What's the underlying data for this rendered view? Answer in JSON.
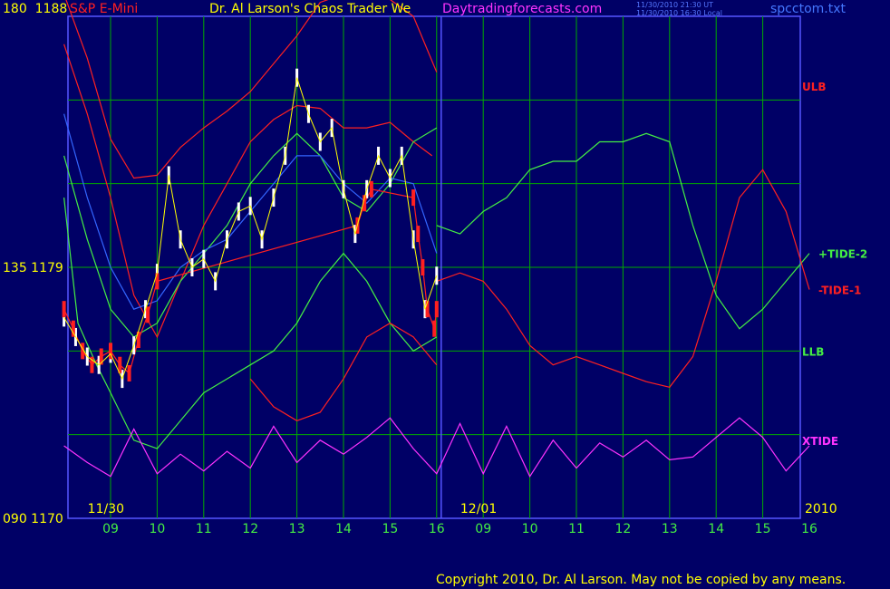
{
  "header": {
    "left_scale": "180",
    "left_price": "1188",
    "instrument": "S&P E-Mini",
    "title": "Dr. Al Larson's Chaos Trader We",
    "site": "Daytradingforecasts.com",
    "stamp_ut": "11/30/2010 21:30 UT",
    "stamp_local": "11/30/2010 16:30 Local",
    "file": "spcctom.txt"
  },
  "footer": {
    "copyright": "Copyright 2010, Dr. Al Larson. May not be copied by any means."
  },
  "colors": {
    "background": "#000066",
    "grid": "#00aa00",
    "axis": "#5555ff",
    "white": "#ffffff",
    "red": "#ff2020",
    "green": "#44ee44",
    "magenta": "#ff33ff",
    "yellow": "#ffff00",
    "blue": "#3366ff"
  },
  "chart_data": {
    "type": "line",
    "title": "Dr. Al Larson's Chaos Trader We",
    "left_axis": {
      "ticks": [
        {
          "label": "180  1188",
          "price": 1188
        },
        {
          "label": "135  1179",
          "price": 1179
        },
        {
          "label": "090  1170",
          "price": 1170
        }
      ]
    },
    "y_range": [
      1170,
      1188
    ],
    "x_range": [
      8,
      16.15
    ],
    "day_labels": [
      {
        "text": "11/30",
        "x": 8.9
      },
      {
        "text": "12/01",
        "x": 16.9
      }
    ],
    "year_label": "2010",
    "hour_ticks": [
      {
        "label": "09",
        "x": 9
      },
      {
        "label": "10",
        "x": 10
      },
      {
        "label": "11",
        "x": 11
      },
      {
        "label": "12",
        "x": 12
      },
      {
        "label": "13",
        "x": 13
      },
      {
        "label": "14",
        "x": 14
      },
      {
        "label": "15",
        "x": 15
      },
      {
        "label": "16",
        "x": 16
      },
      {
        "label": "09",
        "x": 17
      },
      {
        "label": "10",
        "x": 18
      },
      {
        "label": "11",
        "x": 19
      },
      {
        "label": "12",
        "x": 20
      },
      {
        "label": "13",
        "x": 21
      },
      {
        "label": "14",
        "x": 22
      },
      {
        "label": "15",
        "x": 23
      },
      {
        "label": "16",
        "x": 24
      }
    ],
    "legend": [
      {
        "name": "ULB",
        "color": "#ff2020",
        "price": 1185.5
      },
      {
        "name": "+TIDE-2",
        "color": "#44ee44",
        "price": 1179.5
      },
      {
        "name": "-TIDE-1",
        "color": "#ff2020",
        "price": 1178.2
      },
      {
        "name": "LLB",
        "color": "#44ee44",
        "price": 1176.0
      },
      {
        "name": "XTIDE",
        "color": "#ff33ff",
        "price": 1172.8
      }
    ],
    "series": [
      {
        "name": "ULB",
        "color": "#ff2020",
        "x": [
          8,
          8.5,
          9,
          9.5,
          10,
          10.5,
          11,
          11.5,
          12,
          12.5,
          13,
          13.5,
          14,
          14.5,
          15,
          15.5,
          16
        ],
        "y": [
          1188.8,
          1186.5,
          1183.6,
          1182.2,
          1182.3,
          1183.3,
          1184.0,
          1184.6,
          1185.3,
          1186.3,
          1187.3,
          1188.5,
          1188.8,
          1188.8,
          1188.6,
          1188.0,
          1186.0
        ]
      },
      {
        "name": "upper-envelope",
        "color": "#ff2020",
        "x": [
          8,
          8.5,
          9,
          9.5,
          10,
          10.5,
          11,
          11.5,
          12,
          12.5,
          13,
          13.5,
          14,
          14.5,
          15,
          15.5,
          15.9
        ],
        "y": [
          1187.0,
          1184.5,
          1181.5,
          1178.0,
          1176.5,
          1178.5,
          1180.5,
          1182.0,
          1183.5,
          1184.3,
          1184.8,
          1184.7,
          1184.0,
          1184.0,
          1184.2,
          1183.5,
          1183.0
        ]
      },
      {
        "name": "mid-band",
        "color": "#44ee44",
        "x": [
          8,
          8.5,
          9,
          9.5,
          10,
          10.5,
          11,
          11.5,
          12,
          12.5,
          13,
          13.5,
          14,
          14.5,
          15,
          15.5,
          16
        ],
        "y": [
          1183.0,
          1180.0,
          1177.5,
          1176.5,
          1177.0,
          1178.5,
          1179.5,
          1180.5,
          1182.0,
          1183.0,
          1183.8,
          1183.0,
          1181.5,
          1181.0,
          1182.0,
          1183.5,
          1184.0
        ]
      },
      {
        "name": "LLB",
        "color": "#44ee44",
        "x": [
          8,
          8.3,
          8.7,
          9,
          9.5,
          10,
          10.5,
          11,
          11.5,
          12,
          12.5,
          13,
          13.5,
          14,
          14.5,
          15,
          15.5,
          16
        ],
        "y": [
          1181.5,
          1177.0,
          1175.5,
          1174.5,
          1172.8,
          1172.5,
          1173.5,
          1174.5,
          1175.0,
          1175.5,
          1176.0,
          1177.0,
          1178.5,
          1179.5,
          1178.5,
          1177.0,
          1176.0,
          1176.5
        ]
      },
      {
        "name": "lower-red",
        "color": "#ff2020",
        "x": [
          12,
          12.5,
          13,
          13.5,
          14,
          14.5,
          15,
          15.5,
          16
        ],
        "y": [
          1175.0,
          1174.0,
          1173.5,
          1173.8,
          1175.0,
          1176.5,
          1177.0,
          1176.5,
          1175.5
        ]
      },
      {
        "name": "blue-average",
        "color": "#3366ff",
        "x": [
          8,
          8.5,
          9,
          9.5,
          10,
          10.5,
          11,
          11.5,
          12,
          12.5,
          13,
          13.5,
          14,
          14.5,
          15,
          15.5,
          16
        ],
        "y": [
          1184.5,
          1181.5,
          1179.0,
          1177.5,
          1177.8,
          1179.0,
          1179.6,
          1180.0,
          1181.0,
          1182.0,
          1183.0,
          1183.0,
          1182.0,
          1181.3,
          1182.2,
          1182.0,
          1179.5
        ]
      },
      {
        "name": "+TIDE-2",
        "color": "#44ee44",
        "x": [
          16,
          16.5,
          17,
          17.5,
          18,
          18.5,
          19,
          19.5,
          20,
          20.5,
          21,
          21.5,
          22,
          22.5,
          23,
          23.5,
          24
        ],
        "y": [
          1180.5,
          1180.2,
          1181.0,
          1181.5,
          1182.5,
          1182.8,
          1182.8,
          1183.5,
          1183.5,
          1183.8,
          1183.5,
          1180.5,
          1178.0,
          1176.8,
          1177.5,
          1178.5,
          1179.5
        ]
      },
      {
        "name": "-TIDE-1",
        "color": "#ff2020",
        "x": [
          16,
          16.5,
          17,
          17.5,
          18,
          18.5,
          19,
          19.5,
          20,
          20.5,
          21,
          21.5,
          22,
          22.5,
          23,
          23.5,
          24
        ],
        "y": [
          1178.5,
          1178.8,
          1178.5,
          1177.5,
          1176.2,
          1175.5,
          1175.8,
          1175.5,
          1175.2,
          1174.9,
          1174.7,
          1175.8,
          1178.5,
          1181.5,
          1182.5,
          1181.0,
          1178.2
        ]
      },
      {
        "name": "XTIDE",
        "color": "#ff33ff",
        "x": [
          8,
          8.5,
          9,
          9.5,
          10,
          10.5,
          11,
          11.5,
          12,
          12.5,
          13,
          13.5,
          14,
          14.5,
          15,
          15.5,
          16,
          16.5,
          17,
          17.5,
          18,
          18.5,
          19,
          19.5,
          20,
          20.5,
          21,
          21.5,
          22,
          22.5,
          23,
          23.5,
          24
        ],
        "y": [
          1172.6,
          1172.0,
          1171.5,
          1173.2,
          1171.6,
          1172.3,
          1171.7,
          1172.4,
          1171.8,
          1173.3,
          1172.0,
          1172.8,
          1172.3,
          1172.9,
          1173.6,
          1172.5,
          1171.6,
          1173.4,
          1171.6,
          1173.3,
          1171.5,
          1172.8,
          1171.8,
          1172.7,
          1172.2,
          1172.8,
          1172.1,
          1172.2,
          1172.9,
          1173.6,
          1172.9,
          1171.7,
          1172.6
        ]
      },
      {
        "name": "price-close",
        "color": "#ffffff",
        "x": [
          8,
          8.25,
          8.5,
          8.75,
          9,
          9.25,
          9.5,
          9.75,
          10,
          10.25,
          10.5,
          10.75,
          11,
          11.25,
          11.5,
          11.75,
          12,
          12.25,
          12.5,
          12.75,
          13,
          13.25,
          13.5,
          13.75,
          14,
          14.25,
          14.5,
          14.75,
          15,
          15.25,
          15.5,
          15.75,
          16
        ],
        "y": [
          1177.2,
          1176.5,
          1175.8,
          1175.5,
          1175.9,
          1175.0,
          1176.2,
          1177.5,
          1178.8,
          1182.3,
          1180.0,
          1179.0,
          1179.3,
          1178.5,
          1180.0,
          1181.0,
          1181.2,
          1180.0,
          1181.5,
          1183.0,
          1185.8,
          1184.5,
          1183.5,
          1184.0,
          1181.8,
          1180.2,
          1181.8,
          1183.0,
          1182.2,
          1183.0,
          1180.0,
          1177.5,
          1178.7
        ]
      },
      {
        "name": "price-red",
        "color": "#ff2020",
        "x": [
          8,
          8.2,
          8.4,
          8.6,
          8.8,
          9,
          9.2,
          9.4,
          9.6,
          9.8,
          10,
          14.3,
          14.45,
          14.6,
          15.5,
          15.6,
          15.7,
          15.8,
          15.95,
          16
        ],
        "y": [
          1177.5,
          1176.8,
          1176.0,
          1175.5,
          1175.8,
          1176.0,
          1175.5,
          1175.2,
          1176.4,
          1177.3,
          1178.5,
          1180.5,
          1181.3,
          1181.8,
          1181.5,
          1180.2,
          1179.0,
          1177.5,
          1176.8,
          1177.5
        ]
      }
    ]
  }
}
